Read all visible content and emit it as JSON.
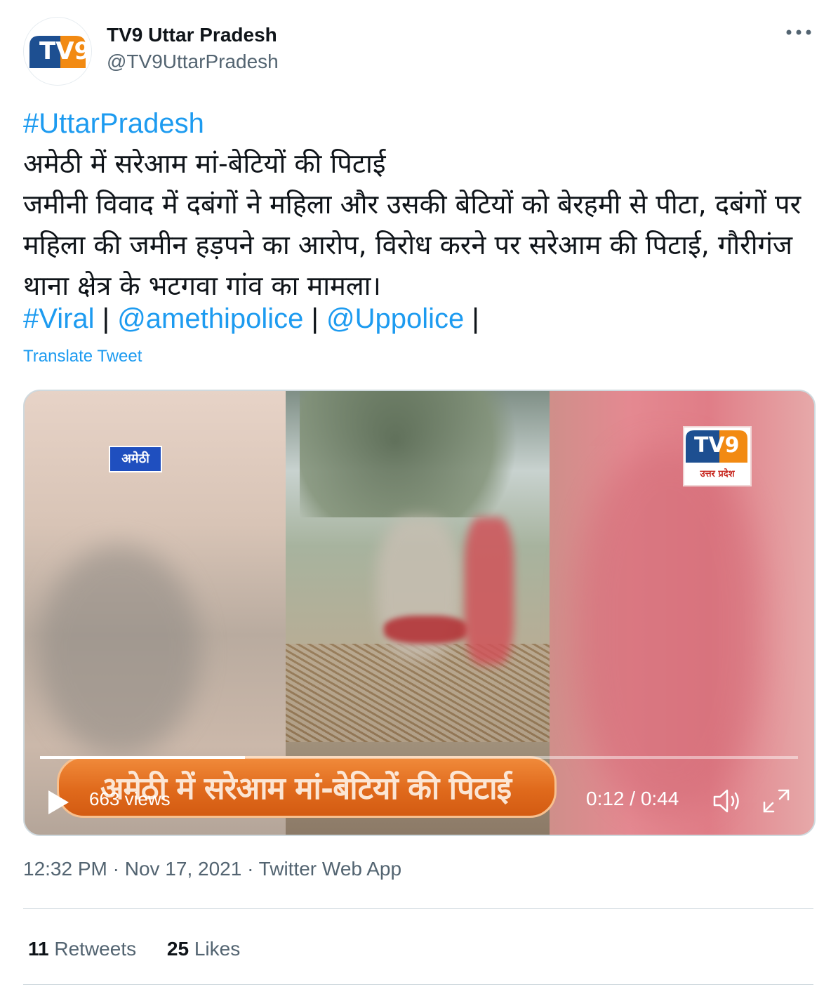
{
  "author": {
    "display_name": "TV9 Uttar Pradesh",
    "handle": "@TV9UttarPradesh",
    "avatar_logo": "TV9"
  },
  "tweet": {
    "hashtag_top": "#UttarPradesh",
    "headline": "अमेठी में सरेआम मां-बेटियों की पिटाई",
    "body": "जमीनी विवाद में दबंगों ने महिला और उसकी बेटियों को बेरहमी से पीटा, दबंगों पर महिला की जमीन हड़पने का आरोप, विरोध करने पर सरेआम की पिटाई, गौरीगंज थाना क्षेत्र के भटगवा गांव का मामला।",
    "tag_viral": "#Viral",
    "tag_amethi": "@amethipolice",
    "tag_uppolice": "@Uppolice",
    "separator": "|",
    "translate": "Translate Tweet"
  },
  "video": {
    "badge": "अमेठी",
    "channel_logo": "TV9",
    "channel_sub": "उत्तर प्रदेश",
    "caption": "अमेठी में सरेआम मां-बेटियों की पिटाई",
    "views": "663 views",
    "time": "0:12 / 0:44",
    "progress": 0.27
  },
  "meta": {
    "timestamp": "12:32 PM · Nov 17, 2021 · Twitter Web App"
  },
  "stats": {
    "retweets_count": "11",
    "retweets_label": "Retweets",
    "likes_count": "25",
    "likes_label": "Likes"
  },
  "colors": {
    "link": "#1d9bf0",
    "secondary_text": "#536471",
    "caption_orange": "#e06a1c"
  },
  "icons": [
    "more-icon",
    "play-icon",
    "volume-icon",
    "fullscreen-icon"
  ]
}
